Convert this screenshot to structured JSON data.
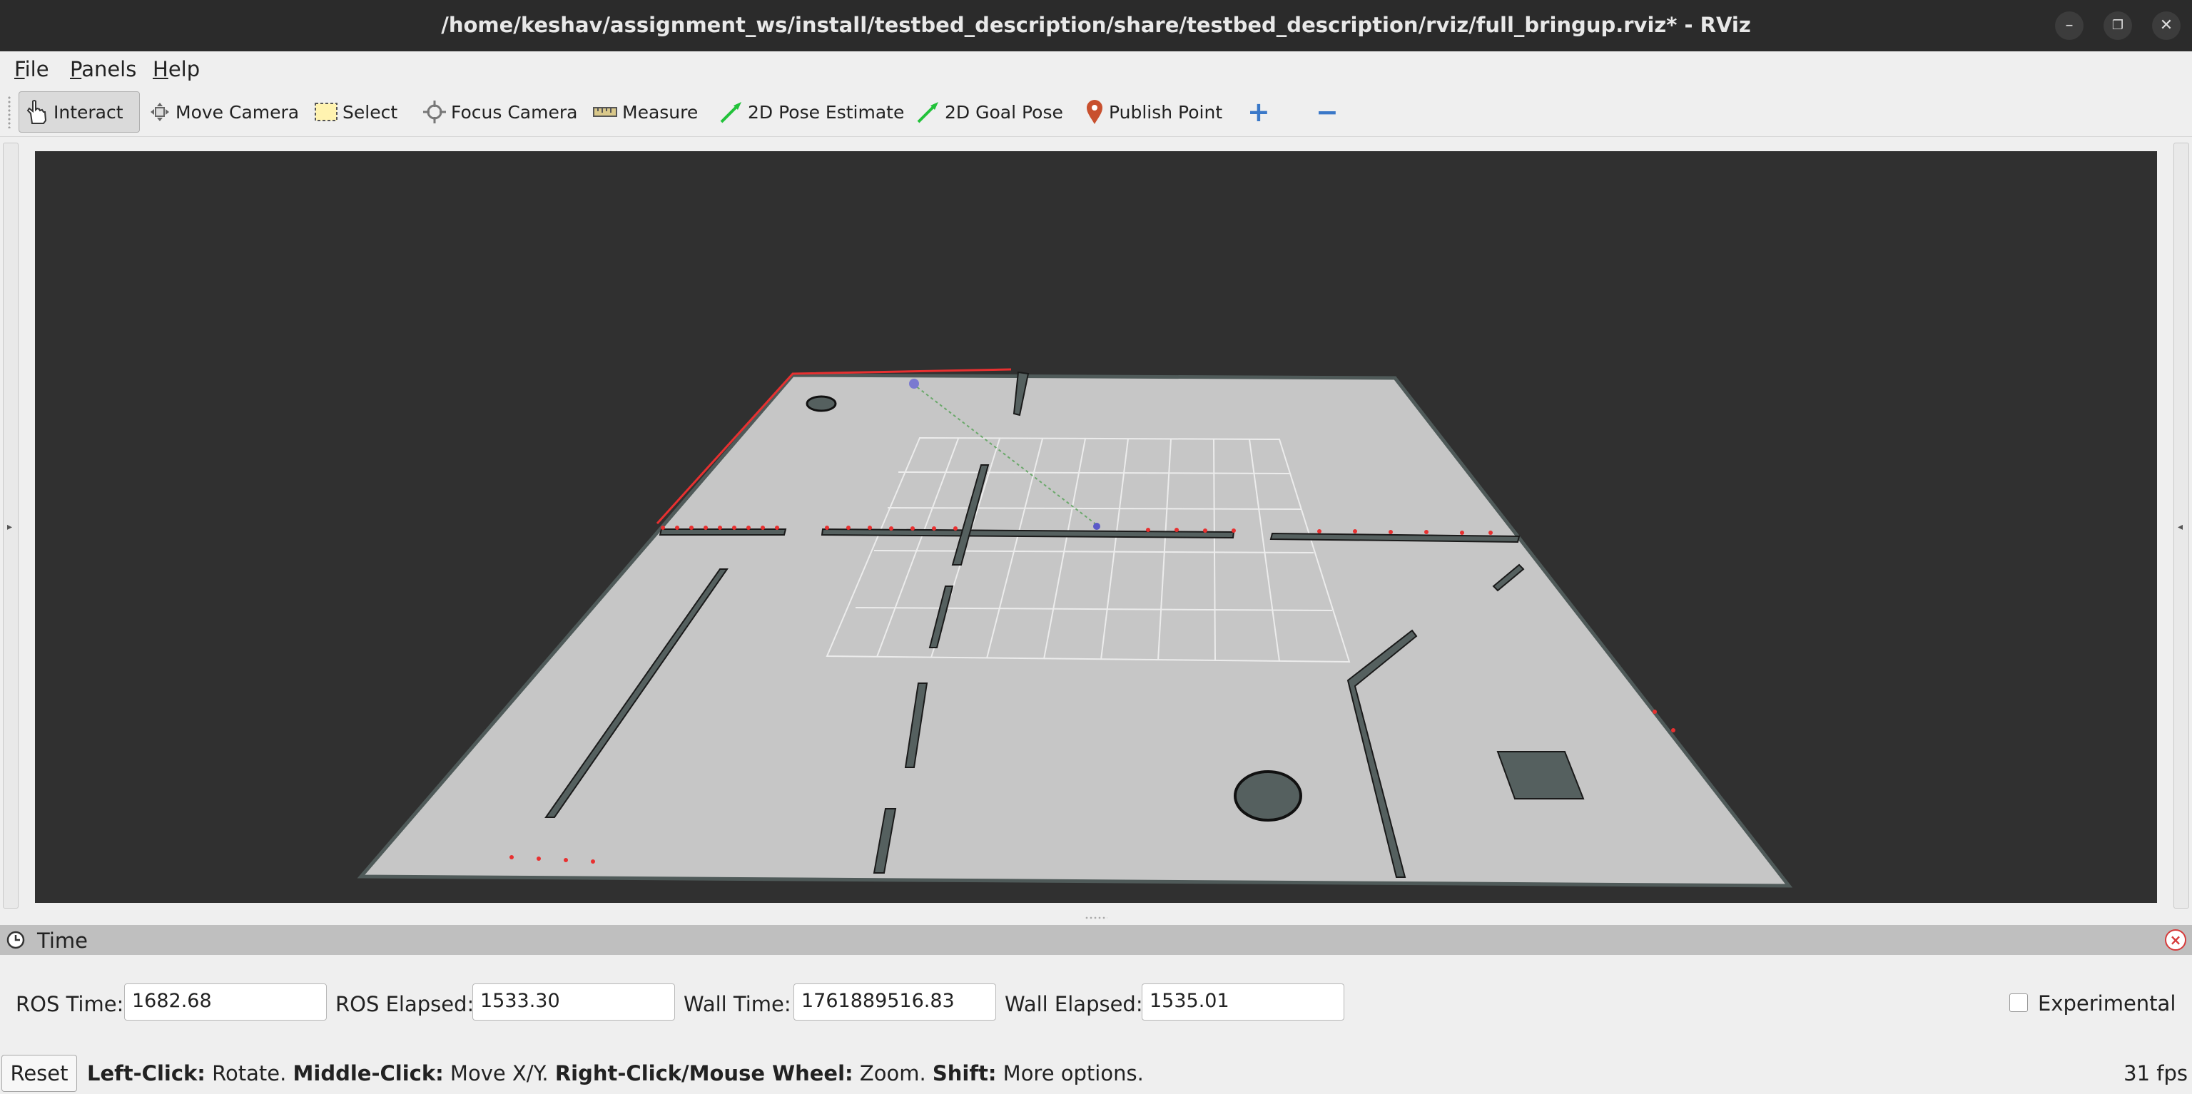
{
  "window": {
    "title": "/home/keshav/assignment_ws/install/testbed_description/share/testbed_description/rviz/full_bringup.rviz* - RViz",
    "minimize_glyph": "–",
    "restore_glyph": "❐",
    "close_glyph": "✕"
  },
  "menubar": {
    "items": [
      {
        "label": "File",
        "accel": "F",
        "rest": "ile"
      },
      {
        "label": "Panels",
        "accel": "P",
        "rest": "anels"
      },
      {
        "label": "Help",
        "accel": "H",
        "rest": "elp"
      }
    ]
  },
  "toolbar": {
    "tools": [
      {
        "label": "Interact",
        "icon": "hand-pointer-icon",
        "active": true
      },
      {
        "label": "Move Camera",
        "icon": "move-arrows-icon",
        "active": false
      },
      {
        "label": "Select",
        "icon": "dashed-rect-icon",
        "active": false
      },
      {
        "label": "Focus Camera",
        "icon": "crosshair-icon",
        "active": false
      },
      {
        "label": "Measure",
        "icon": "ruler-icon",
        "active": false
      },
      {
        "label": "2D Pose Estimate",
        "icon": "green-arrow-icon",
        "active": false
      },
      {
        "label": "2D Goal Pose",
        "icon": "green-arrow-icon",
        "active": false
      },
      {
        "label": "Publish Point",
        "icon": "map-pin-icon",
        "active": false
      }
    ],
    "add_tool_glyph": "+",
    "remove_tool_glyph": "−",
    "colors": {
      "pose_arrow": "#22c23a",
      "pin": "#c8502e",
      "add_remove": "#3a78c8"
    }
  },
  "viewport": {
    "description": "3D map view",
    "colors": {
      "background": "#303030",
      "floor": "#c6c6c6",
      "walls": "#4f5a59",
      "laser": "#e83030",
      "grid": "#e8e8e8"
    }
  },
  "time_panel": {
    "title": "Time",
    "ros_time_label": "ROS Time:",
    "ros_time_value": "1682.68",
    "ros_elapsed_label": "ROS Elapsed:",
    "ros_elapsed_value": "1533.30",
    "wall_time_label": "Wall Time:",
    "wall_time_value": "1761889516.83",
    "wall_elapsed_label": "Wall Elapsed:",
    "wall_elapsed_value": "1535.01",
    "experimental_label": "Experimental",
    "experimental_checked": false
  },
  "status": {
    "reset_label": "Reset",
    "hint_parts": [
      {
        "bold": "Left-Click:",
        "text": " Rotate. "
      },
      {
        "bold": "Middle-Click:",
        "text": " Move X/Y. "
      },
      {
        "bold": "Right-Click/Mouse Wheel:",
        "text": " Zoom. "
      },
      {
        "bold": "Shift:",
        "text": " More options."
      }
    ],
    "fps": "31 fps"
  }
}
